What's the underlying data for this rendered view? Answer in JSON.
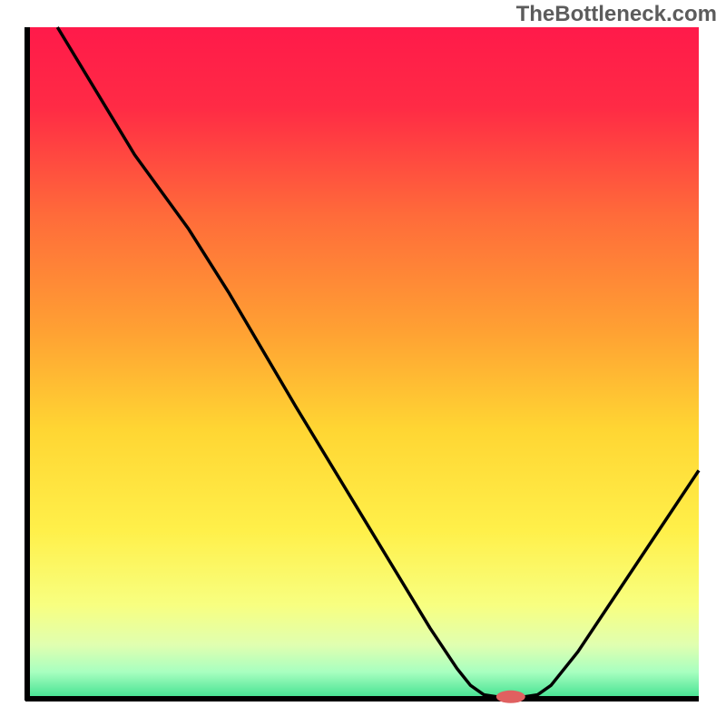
{
  "watermark": "TheBottleneck.com",
  "chart_data": {
    "type": "line",
    "title": "",
    "xlabel": "",
    "ylabel": "",
    "xlim": [
      0,
      100
    ],
    "ylim": [
      0,
      100
    ],
    "background_gradient": {
      "stops": [
        {
          "offset": 0.0,
          "color": "#ff1a4a"
        },
        {
          "offset": 0.12,
          "color": "#ff2b45"
        },
        {
          "offset": 0.28,
          "color": "#ff6b3a"
        },
        {
          "offset": 0.45,
          "color": "#ffa033"
        },
        {
          "offset": 0.6,
          "color": "#ffd633"
        },
        {
          "offset": 0.75,
          "color": "#fff04a"
        },
        {
          "offset": 0.86,
          "color": "#f8ff80"
        },
        {
          "offset": 0.92,
          "color": "#e0ffb0"
        },
        {
          "offset": 0.96,
          "color": "#a8ffc0"
        },
        {
          "offset": 1.0,
          "color": "#40e090"
        }
      ]
    },
    "curve_points": [
      {
        "x": 4.5,
        "y": 100
      },
      {
        "x": 16,
        "y": 81
      },
      {
        "x": 24,
        "y": 70
      },
      {
        "x": 30,
        "y": 60.5
      },
      {
        "x": 40,
        "y": 43.5
      },
      {
        "x": 50,
        "y": 27
      },
      {
        "x": 60,
        "y": 10.5
      },
      {
        "x": 64,
        "y": 4.5
      },
      {
        "x": 66,
        "y": 2
      },
      {
        "x": 68,
        "y": 0.6
      },
      {
        "x": 70,
        "y": 0.3
      },
      {
        "x": 74,
        "y": 0.3
      },
      {
        "x": 76,
        "y": 0.6
      },
      {
        "x": 78,
        "y": 2
      },
      {
        "x": 82,
        "y": 7
      },
      {
        "x": 88,
        "y": 16
      },
      {
        "x": 94,
        "y": 25
      },
      {
        "x": 100,
        "y": 34
      }
    ],
    "optimum_marker": {
      "x": 72,
      "y": 0.3,
      "color": "#e06060",
      "rx": 16,
      "ry": 7
    }
  }
}
